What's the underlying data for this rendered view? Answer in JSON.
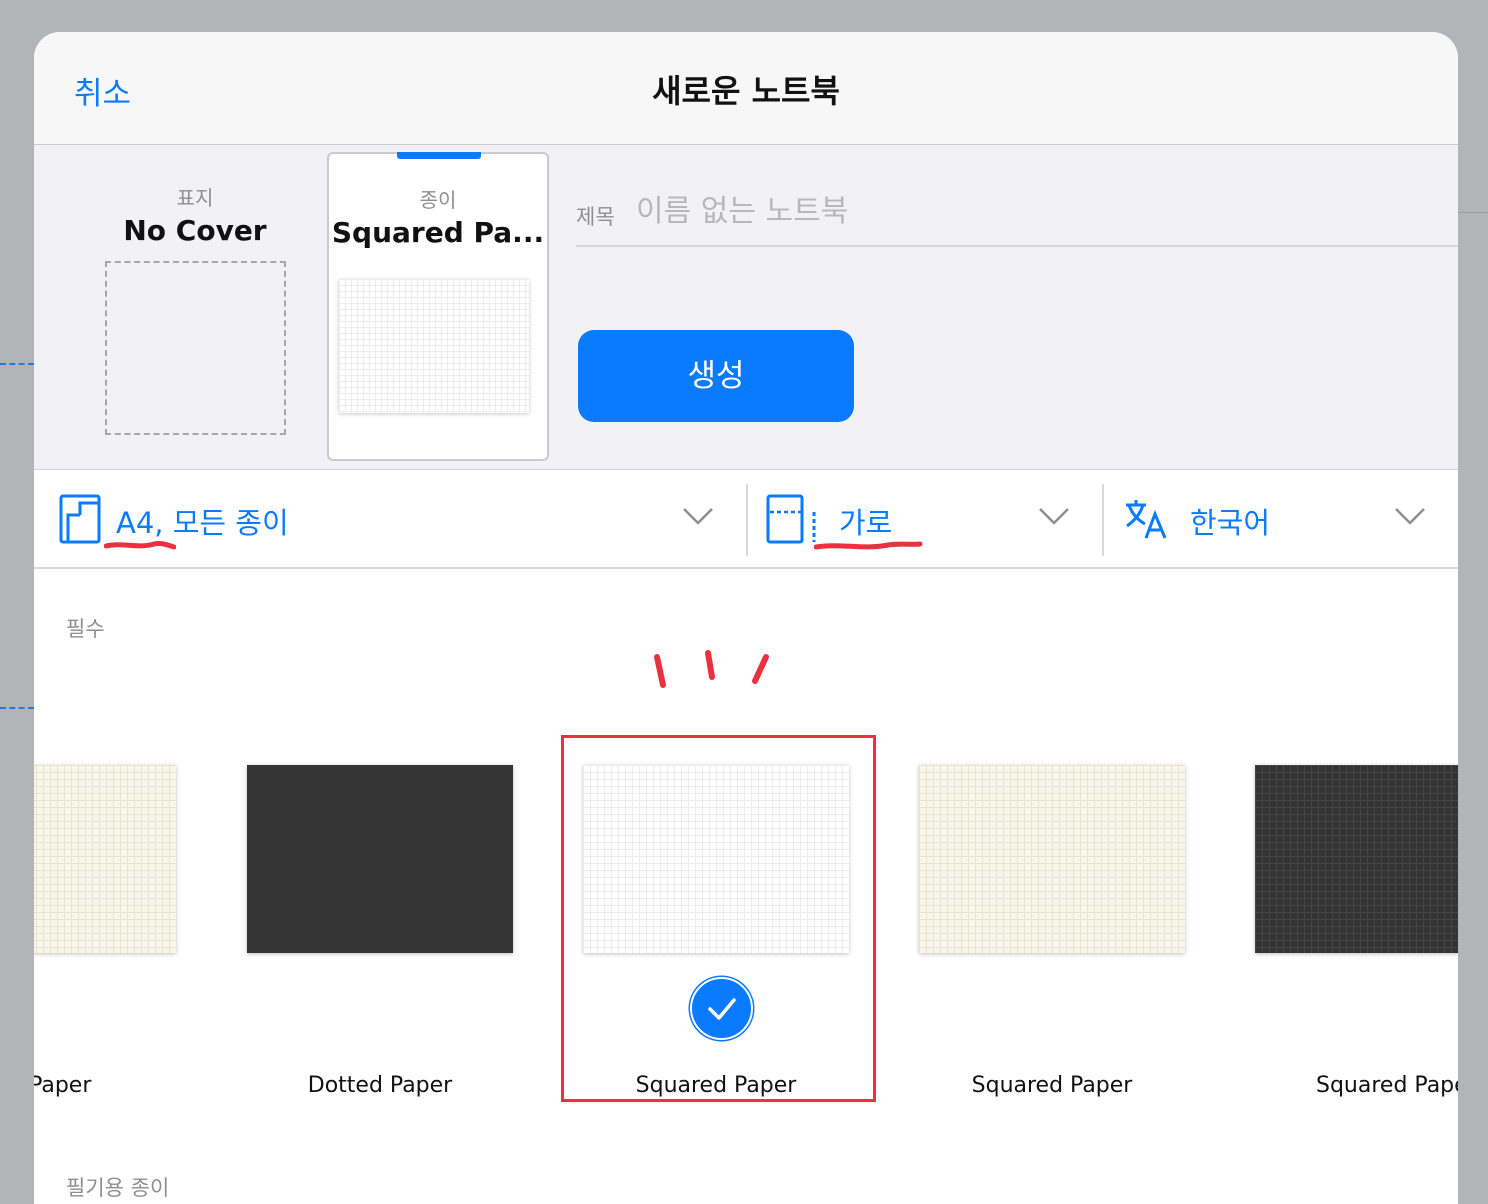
{
  "dialog": {
    "title": "새로운 노트북",
    "cancel_label": "취소"
  },
  "cover": {
    "caption": "표지",
    "name": "No Cover"
  },
  "paper": {
    "caption": "종이",
    "name": "Squared Pa..."
  },
  "title_field": {
    "label": "제목",
    "placeholder": "이름 없는 노트북",
    "value": ""
  },
  "create_label": "생성",
  "options": {
    "paper_size": "A4, 모든 종이",
    "orientation": "가로",
    "language": "한국어"
  },
  "sections": {
    "essential": "필수",
    "writing": "필기용 종이"
  },
  "templates": [
    {
      "label": "ed Paper",
      "style": "cream"
    },
    {
      "label": "Dotted Paper",
      "style": "dark"
    },
    {
      "label": "Squared Paper",
      "style": "white",
      "selected": true
    },
    {
      "label": "Squared Paper",
      "style": "cream"
    },
    {
      "label": "Squared Pape",
      "style": "dark"
    }
  ],
  "colors": {
    "accent": "#0a7aff",
    "annotation_red": "#e8323f"
  }
}
